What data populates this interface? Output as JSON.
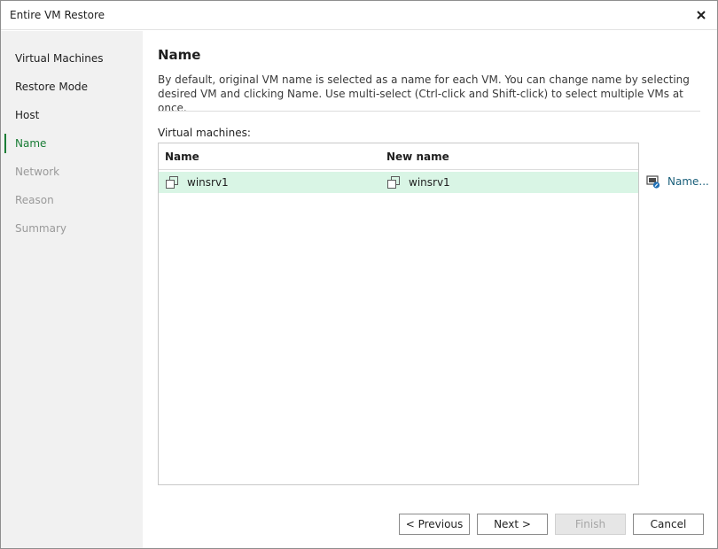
{
  "window": {
    "title": "Entire VM Restore"
  },
  "sidebar": {
    "steps": [
      {
        "label": "Virtual Machines",
        "state": "done"
      },
      {
        "label": "Restore Mode",
        "state": "done"
      },
      {
        "label": "Host",
        "state": "done"
      },
      {
        "label": "Name",
        "state": "active"
      },
      {
        "label": "Network",
        "state": "pending"
      },
      {
        "label": "Reason",
        "state": "pending"
      },
      {
        "label": "Summary",
        "state": "pending"
      }
    ]
  },
  "page": {
    "title": "Name",
    "description": "By default, original VM name is selected as a name for each VM. You can change name by selecting desired VM and clicking Name. Use multi-select (Ctrl-click and Shift-click) to select multiple VMs at once.",
    "list_label": "Virtual machines:"
  },
  "table": {
    "columns": [
      "Name",
      "New name"
    ],
    "rows": [
      {
        "name": "winsrv1",
        "new_name": "winsrv1",
        "selected": true
      }
    ]
  },
  "actions": {
    "name_label": "Name..."
  },
  "footer": {
    "previous": "< Previous",
    "next": "Next >",
    "finish": "Finish",
    "cancel": "Cancel"
  },
  "colors": {
    "accent": "#1a7d36",
    "selection": "#d9f5e5",
    "sidebar_bg": "#f1f1f1",
    "link": "#1a5f7a"
  },
  "icons": {
    "close": "close-icon",
    "vm": "vm-icon",
    "rename": "rename-icon"
  }
}
